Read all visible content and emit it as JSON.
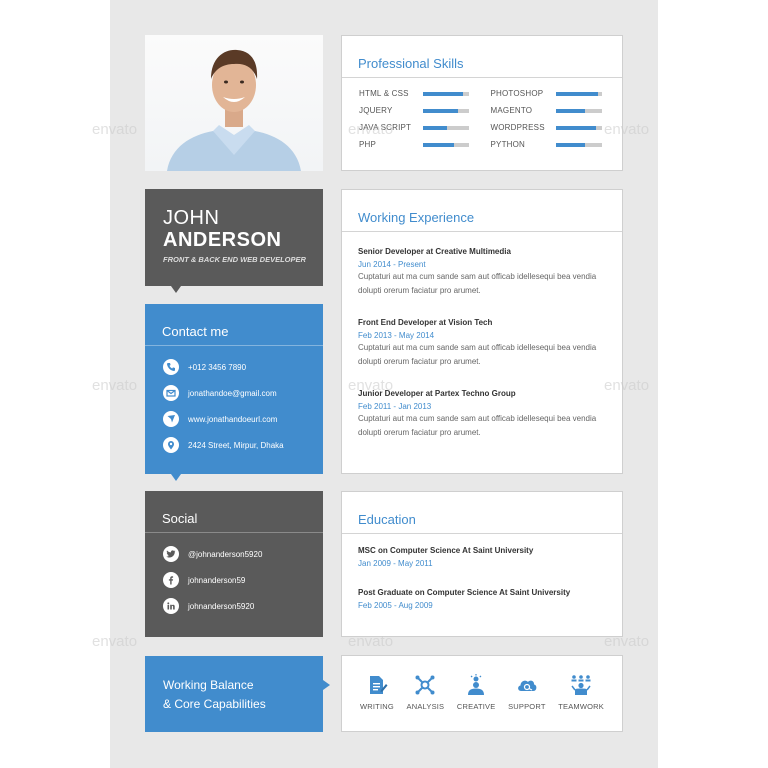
{
  "colors": {
    "accent": "#418ccd",
    "dark": "#5a5a5a",
    "sheet": "#e8e8e8"
  },
  "watermark": "envato",
  "profile": {
    "first_name": "JOHN",
    "last_name": "ANDERSON",
    "role": "FRONT & BACK END WEB DEVELOPER"
  },
  "skills": {
    "title": "Professional Skills",
    "left": [
      {
        "name": "HTML & CSS",
        "level": 0.88
      },
      {
        "name": "JQUERY",
        "level": 0.75
      },
      {
        "name": "JAVA SCRIPT",
        "level": 0.53
      },
      {
        "name": "PHP",
        "level": 0.68
      }
    ],
    "right": [
      {
        "name": "PHOTOSHOP",
        "level": 0.93
      },
      {
        "name": "MAGENTO",
        "level": 0.65
      },
      {
        "name": "WORDPRESS",
        "level": 0.88
      },
      {
        "name": "PYTHON",
        "level": 0.65
      }
    ]
  },
  "experience": {
    "title": "Working Experience",
    "items": [
      {
        "title": "Senior Developer at Creative Multimedia",
        "date": "Jun 2014 - Present",
        "desc": "Cuptaturi aut ma cum sande sam aut officab idellesequi bea vendia dolupti orerum faciatur pro arumet."
      },
      {
        "title": "Front End Developer at Vision Tech",
        "date": "Feb 2013 - May 2014",
        "desc": "Cuptaturi aut ma cum sande sam aut officab idellesequi bea vendia dolupti orerum faciatur pro arumet."
      },
      {
        "title": "Junior Developer at Partex Techno Group",
        "date": "Feb 2011 - Jan 2013",
        "desc": "Cuptaturi aut ma cum sande sam aut officab idellesequi bea vendia dolupti orerum faciatur pro arumet."
      }
    ]
  },
  "contact": {
    "title": "Contact me",
    "items": [
      {
        "icon": "phone-icon",
        "text": "+012 3456 7890"
      },
      {
        "icon": "email-icon",
        "text": "jonathandoe@gmail.com"
      },
      {
        "icon": "website-icon",
        "text": "www.jonathandoeurl.com"
      },
      {
        "icon": "location-icon",
        "text": "2424 Street, Mirpur, Dhaka"
      }
    ]
  },
  "social": {
    "title": "Social",
    "items": [
      {
        "icon": "twitter-icon",
        "text": "@johnanderson5920"
      },
      {
        "icon": "facebook-icon",
        "text": "johnanderson59"
      },
      {
        "icon": "linkedin-icon",
        "text": "johnanderson5920"
      }
    ]
  },
  "education": {
    "title": "Education",
    "items": [
      {
        "title": "MSC on Computer Science At Saint University",
        "date": "Jan 2009 - May 2011"
      },
      {
        "title": "Post Graduate on Computer Science At Saint University",
        "date": "Feb 2005 - Aug 2009"
      }
    ]
  },
  "balance": {
    "line1": "Working Balance",
    "line2": "& Core Capabilities"
  },
  "core": [
    {
      "icon": "writing-icon",
      "label": "WRITING"
    },
    {
      "icon": "analysis-icon",
      "label": "ANALYSIS"
    },
    {
      "icon": "creative-icon",
      "label": "CREATIVE"
    },
    {
      "icon": "support-icon",
      "label": "SUPPORT"
    },
    {
      "icon": "teamwork-icon",
      "label": "TEAMWORK"
    }
  ]
}
